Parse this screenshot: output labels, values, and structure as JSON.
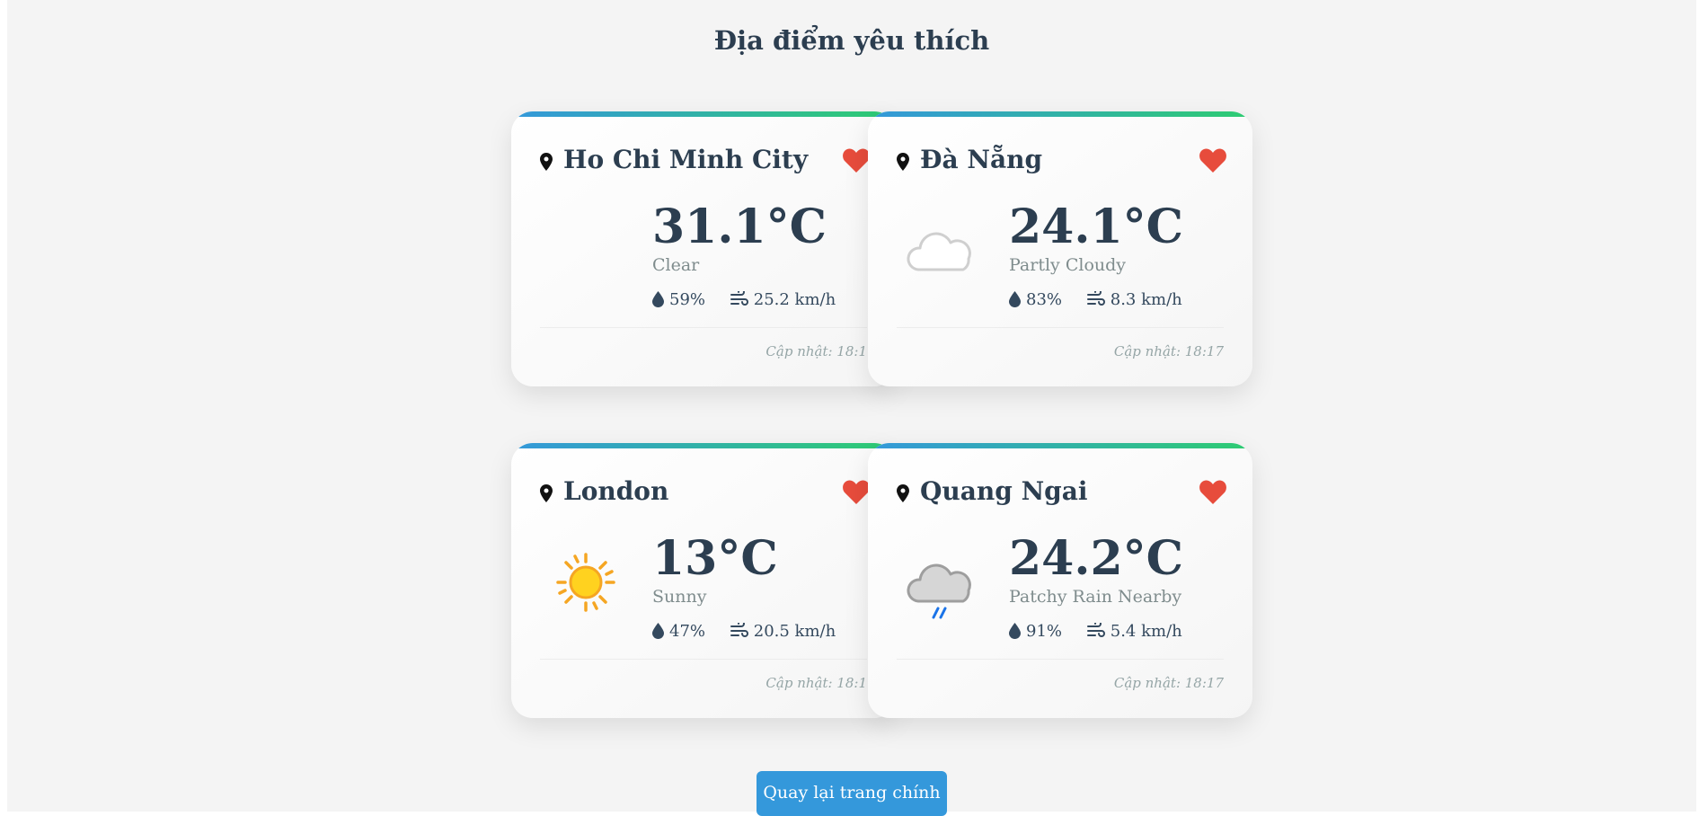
{
  "page": {
    "title": "Địa điểm yêu thích",
    "back_button": "Quay lại trang chính"
  },
  "colors": {
    "accent": "#3498db",
    "accent_end": "#2ecc71",
    "heart": "#e74c3c",
    "title": "#2c3e50"
  },
  "cards": [
    {
      "city": "Ho Chi Minh City",
      "temperature": "31.1°C",
      "condition": "Clear",
      "humidity": "59%",
      "wind": "25.2 km/h",
      "updated": "Cập nhật: 18:1",
      "icon": "moon-icon"
    },
    {
      "city": "Đà Nẵng",
      "temperature": "24.1°C",
      "condition": "Partly Cloudy",
      "humidity": "83%",
      "wind": "8.3 km/h",
      "updated": "Cập nhật: 18:17",
      "icon": "moon-cloud-icon"
    },
    {
      "city": "London",
      "temperature": "13°C",
      "condition": "Sunny",
      "humidity": "47%",
      "wind": "20.5 km/h",
      "updated": "Cập nhật: 18:1",
      "icon": "sun-icon"
    },
    {
      "city": "Quang Ngai",
      "temperature": "24.2°C",
      "condition": "Patchy Rain Nearby",
      "humidity": "91%",
      "wind": "5.4 km/h",
      "updated": "Cập nhật: 18:17",
      "icon": "moon-rain-cloud-icon"
    }
  ]
}
